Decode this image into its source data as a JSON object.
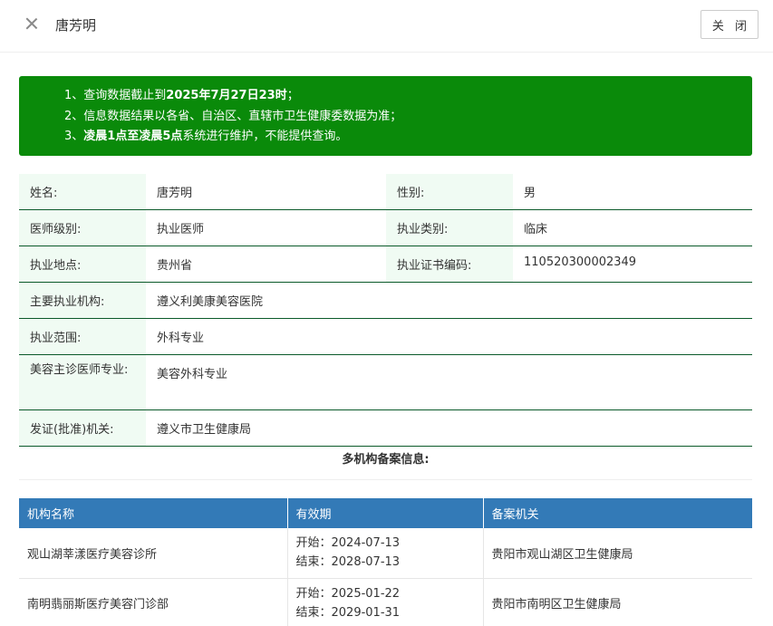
{
  "header": {
    "title": "唐芳明",
    "close_label": "关 闭"
  },
  "notice": {
    "line1_prefix": "1、查询数据截止到",
    "line1_bold": "2025年7月27日23时",
    "line1_suffix": "；",
    "line2": "2、信息数据结果以各省、自治区、直辖市卫生健康委数据为准；",
    "line3_prefix": "3、",
    "line3_bold": "凌晨1点至凌晨5点",
    "line3_suffix": "系统进行维护，不能提供查询。"
  },
  "info": {
    "name_label": "姓名:",
    "name": "唐芳明",
    "gender_label": "性别:",
    "gender": "男",
    "level_label": "医师级别:",
    "level": "执业医师",
    "category_label": "执业类别:",
    "category": "临床",
    "location_label": "执业地点:",
    "location": "贵州省",
    "cert_label": "执业证书编码:",
    "cert": "110520300002349",
    "institution_label": "主要执业机构:",
    "institution": "遵义利美康美容医院",
    "scope_label": "执业范围:",
    "scope": "外科专业",
    "cosmetic_label": "美容主诊医师专业:",
    "cosmetic": "美容外科专业",
    "issuer_label": "发证(批准)机关:",
    "issuer": "遵义市卫生健康局"
  },
  "multi_title": "多机构备案信息:",
  "registrations": {
    "headers": [
      "机构名称",
      "有效期",
      "备案机关"
    ],
    "rows": [
      {
        "name": "观山湖莘漾医疗美容诊所",
        "start": "开始：2024-07-13",
        "end": "结束：2028-07-13",
        "authority": "贵阳市观山湖区卫生健康局"
      },
      {
        "name": "南明翡丽斯医疗美容门诊部",
        "start": "开始：2025-01-22",
        "end": "结束：2029-01-31",
        "authority": "贵阳市南明区卫生健康局"
      }
    ]
  }
}
